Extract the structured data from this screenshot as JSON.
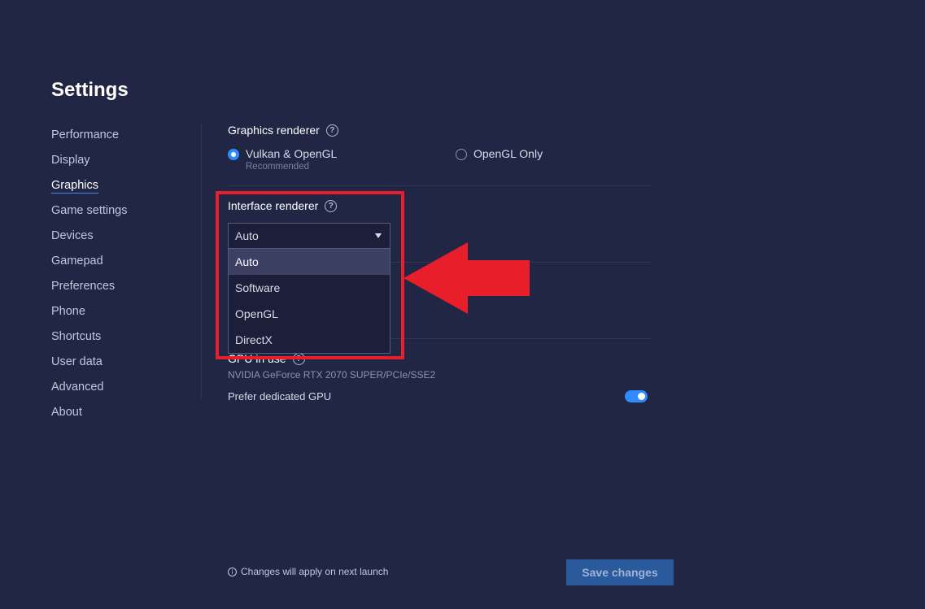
{
  "title": "Settings",
  "sidebar": {
    "items": [
      {
        "label": "Performance"
      },
      {
        "label": "Display"
      },
      {
        "label": "Graphics",
        "active": true
      },
      {
        "label": "Game settings"
      },
      {
        "label": "Devices"
      },
      {
        "label": "Gamepad"
      },
      {
        "label": "Preferences"
      },
      {
        "label": "Phone"
      },
      {
        "label": "Shortcuts"
      },
      {
        "label": "User data"
      },
      {
        "label": "Advanced"
      },
      {
        "label": "About"
      }
    ]
  },
  "graphics_renderer": {
    "label": "Graphics renderer",
    "help_icon": "?",
    "options": [
      {
        "label": "Vulkan & OpenGL",
        "sub": "Recommended",
        "checked": true
      },
      {
        "label": "OpenGL Only",
        "checked": false
      }
    ]
  },
  "interface_renderer": {
    "label": "Interface renderer",
    "help_icon": "?",
    "selected": "Auto",
    "options": [
      "Auto",
      "Software",
      "OpenGL",
      "DirectX"
    ]
  },
  "gpu": {
    "label": "GPU in use",
    "help_icon": "?",
    "value": "NVIDIA GeForce RTX 2070 SUPER/PCIe/SSE2"
  },
  "prefer_dedicated_gpu": {
    "label": "Prefer dedicated GPU",
    "enabled": true
  },
  "footer": {
    "info_icon": "i",
    "note": "Changes will apply on next launch",
    "save_label": "Save changes"
  },
  "colors": {
    "background": "#222645",
    "accent": "#2f8cff",
    "highlight": "#e81e2a",
    "save_button": "#2a5a9c"
  }
}
